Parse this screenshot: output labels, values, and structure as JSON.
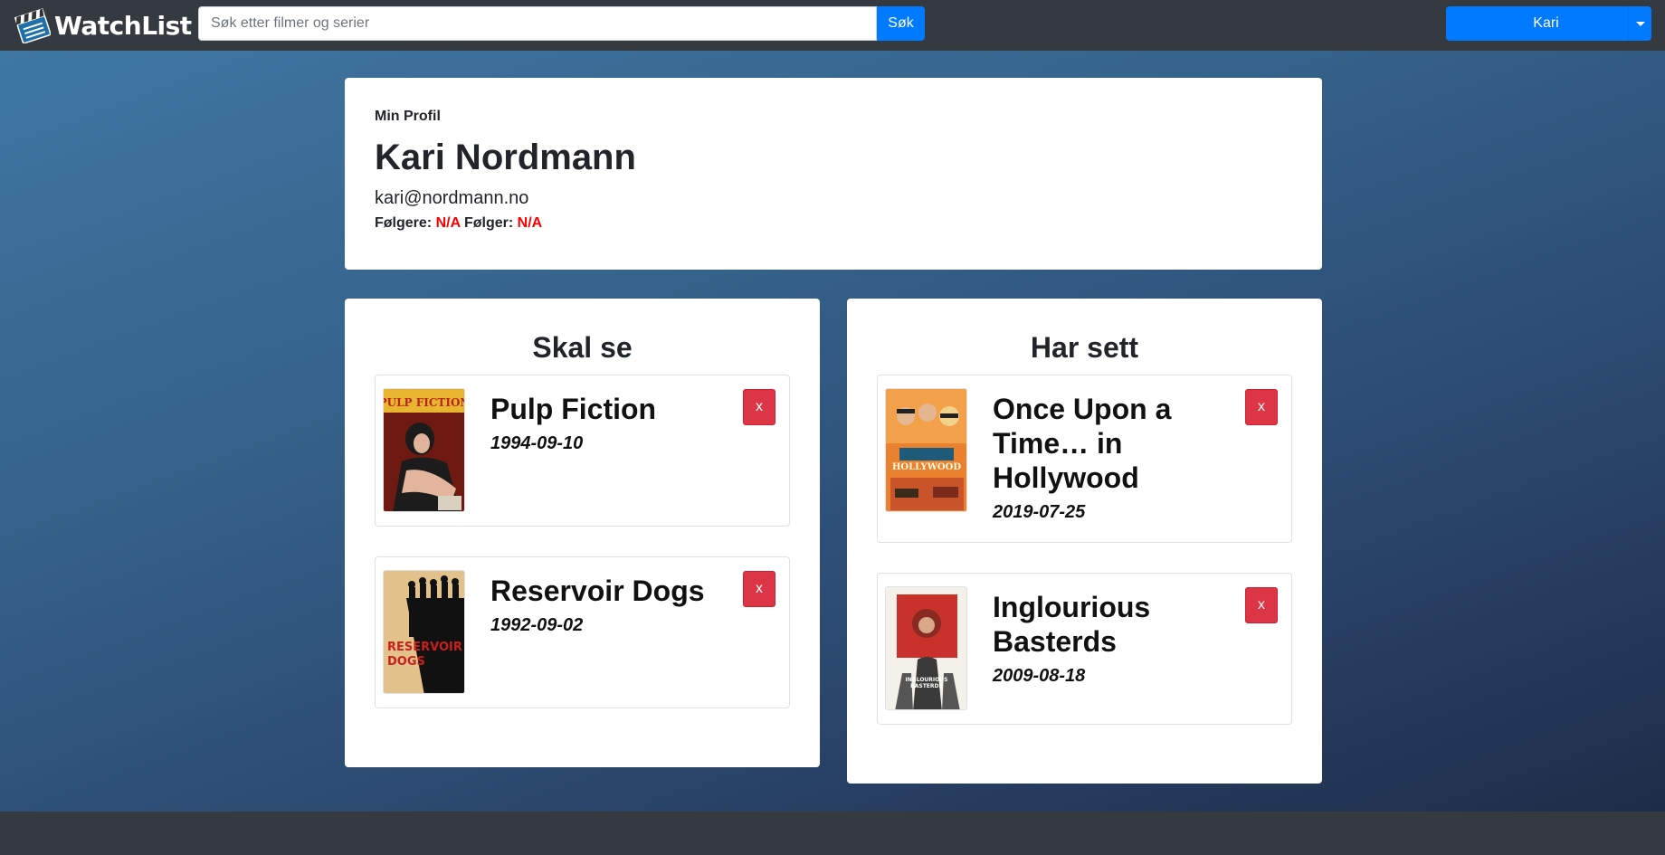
{
  "navbar": {
    "brand": "WatchList",
    "search_placeholder": "Søk etter filmer og serier",
    "search_button": "Søk",
    "user_menu": "Kari"
  },
  "profile": {
    "label": "Min Profil",
    "name": "Kari Nordmann",
    "email": "kari@nordmann.no",
    "followers_label": "Følgere:",
    "followers_value": "N/A",
    "following_label": "Følger:",
    "following_value": "N/A"
  },
  "to_watch": {
    "title": "Skal se",
    "movies": [
      {
        "title": "Pulp Fiction",
        "date": "1994-09-10",
        "remove": "x",
        "poster_text": "PULP FICTION"
      },
      {
        "title": "Reservoir Dogs",
        "date": "1992-09-02",
        "remove": "x",
        "poster_text": "RESERVOIR DOGS"
      }
    ]
  },
  "watched": {
    "title": "Har sett",
    "movies": [
      {
        "title": "Once Upon a Time… in Hollywood",
        "date": "2019-07-25",
        "remove": "x",
        "poster_text": "HOLLYWOOD"
      },
      {
        "title": "Inglourious Basterds",
        "date": "2009-08-18",
        "remove": "x",
        "poster_text": "INGLOURIOUS BASTERDS"
      }
    ]
  },
  "colors": {
    "navbar": "#343a40",
    "primary": "#007bff",
    "danger": "#dc3545",
    "na_value": "#ff0000"
  }
}
